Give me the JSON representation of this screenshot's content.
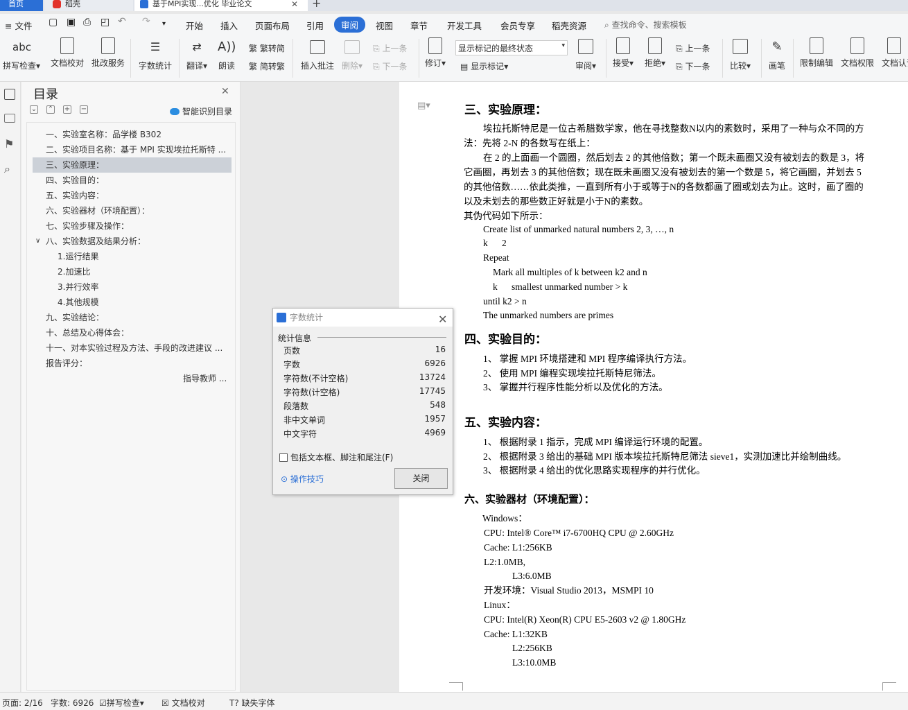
{
  "tabs": {
    "home": "首页",
    "wps": "稻壳",
    "doc": "基于MPI实现...优化 毕业论文"
  },
  "menu": {
    "file": "文件",
    "items": [
      "开始",
      "插入",
      "页面布局",
      "引用",
      "审阅",
      "视图",
      "章节",
      "开发工具",
      "会员专享",
      "稻壳资源"
    ],
    "active": "审阅",
    "search": "查找命令、搜索模板"
  },
  "ribbon": {
    "spell": "拼写检查",
    "proof": "文档校对",
    "review_service": "批改服务",
    "word_count": "字数统计",
    "translate": "翻译",
    "read_aloud": "朗读",
    "trad": "繁转简",
    "simp": "简转繁",
    "insert_comment": "插入批注",
    "delete": "删除",
    "prev": "上一条",
    "next": "下一条",
    "track": "修订",
    "markup_select": "显示标记的最终状态",
    "show_markup": "显示标记",
    "review": "审阅",
    "accept": "接受",
    "reject": "拒绝",
    "prev2": "上一条",
    "next2": "下一条",
    "compare": "比较",
    "pen": "画笔",
    "restrict": "限制编辑",
    "permission": "文档权限",
    "cert": "文档认证"
  },
  "nav": {
    "title": "目录",
    "smart": "智能识别目录",
    "items": [
      {
        "text": "一、实验室名称：品学楼 B302",
        "indent": 0
      },
      {
        "text": "二、实验项目名称：基于 MPI 实现埃拉托斯特 ...",
        "indent": 0
      },
      {
        "text": "三、实验原理：",
        "indent": 0,
        "selected": true
      },
      {
        "text": "四、实验目的：",
        "indent": 0
      },
      {
        "text": "五、实验内容：",
        "indent": 0
      },
      {
        "text": "六、实验器材（环境配置）：",
        "indent": 0
      },
      {
        "text": "七、实验步骤及操作：",
        "indent": 0
      },
      {
        "text": "八、实验数据及结果分析：",
        "indent": 0,
        "expanded": true
      },
      {
        "text": "1.运行结果",
        "indent": 1
      },
      {
        "text": "2.加速比",
        "indent": 1
      },
      {
        "text": "3.并行效率",
        "indent": 1
      },
      {
        "text": "4.其他规模",
        "indent": 1
      },
      {
        "text": "九、实验结论：",
        "indent": 0
      },
      {
        "text": "十、总结及心得体会：",
        "indent": 0
      },
      {
        "text": "十一、对本实验过程及方法、手段的改进建议 ...",
        "indent": 0
      },
      {
        "text": "报告评分：",
        "indent": 0
      },
      {
        "text": "指导教师 ...",
        "indent": 2
      }
    ]
  },
  "doc": {
    "h3": "三、实验原理：",
    "p3a": "埃拉托斯特尼是一位古希腊数学家，他在寻找整数N以内的素数时，采用了一种与众不同的方",
    "p3b": "法：先将 2-N 的各数写在纸上：",
    "p3c": "在 2 的上面画一个圆圈，然后划去 2 的其他倍数；第一个既未画圈又没有被划去的数是 3，将",
    "p3d": "它画圈，再划去 3 的其他倍数；现在既未画圈又没有被划去的第一个数是 5，将它画圈，并划去 5",
    "p3e": "的其他倍数……依此类推，一直到所有小于或等于N的各数都画了圈或划去为止。这时，画了圈的",
    "p3f": "以及未划去的那些数正好就是小于N的素数。",
    "p3g": "其伪代码如下所示：",
    "code1": "Create list of unmarked natural numbers 2, 3, …, n",
    "code2": "k      2",
    "code3": "Repeat",
    "code4": "Mark all multiples of k between k2 and n",
    "code5": "k      smallest unmarked number > k",
    "code6": "until k2 > n",
    "code7": "The unmarked numbers are primes",
    "h4": "四、实验目的：",
    "p4a": "1、 掌握 MPI 环境搭建和 MPI 程序编译执行方法。",
    "p4b": "2、 使用 MPI 编程实现埃拉托斯特尼筛法。",
    "p4c": "3、 掌握并行程序性能分析以及优化的方法。",
    "h5": "五、实验内容：",
    "p5a": "1、 根据附录 1 指示，完成 MPI 编译运行环境的配置。",
    "p5b": "2、 根据附录 3 给出的基础 MPI 版本埃拉托斯特尼筛法 sieve1，实测加速比并绘制曲线。",
    "p5c": "3、 根据附录 4 给出的优化思路实现程序的并行优化。",
    "h6": "六、实验器材（环境配置）：",
    "e1": "Windows：",
    "e2": "CPU: Intel® Core™ i7-6700HQ CPU @ 2.60GHz",
    "e3": "Cache: L1:256KB",
    "e4": "L2:1.0MB,",
    "e5": "L3:6.0MB",
    "e6": "开发环境：Visual Studio 2013，MSMPI 10",
    "e7": "Linux：",
    "e8": "CPU: Intel(R) Xeon(R) CPU E5-2603 v2 @ 1.80GHz",
    "e9": "Cache: L1:32KB",
    "e10": "L2:256KB",
    "e11": "L3:10.0MB"
  },
  "dialog": {
    "title": "字数统计",
    "section": "统计信息",
    "rows": [
      {
        "k": "页数",
        "v": "16"
      },
      {
        "k": "字数",
        "v": "6926"
      },
      {
        "k": "字符数(不计空格)",
        "v": "13724"
      },
      {
        "k": "字符数(计空格)",
        "v": "17745"
      },
      {
        "k": "段落数",
        "v": "548"
      },
      {
        "k": "非中文单词",
        "v": "1957"
      },
      {
        "k": "中文字符",
        "v": "4969"
      }
    ],
    "include": "包括文本框、脚注和尾注(F)",
    "tips": "操作技巧",
    "close": "关闭"
  },
  "status": {
    "page": "页面: 2/16",
    "words": "字数: 6926",
    "spell": "拼写检查",
    "proof": "文档校对",
    "font": "缺失字体"
  }
}
